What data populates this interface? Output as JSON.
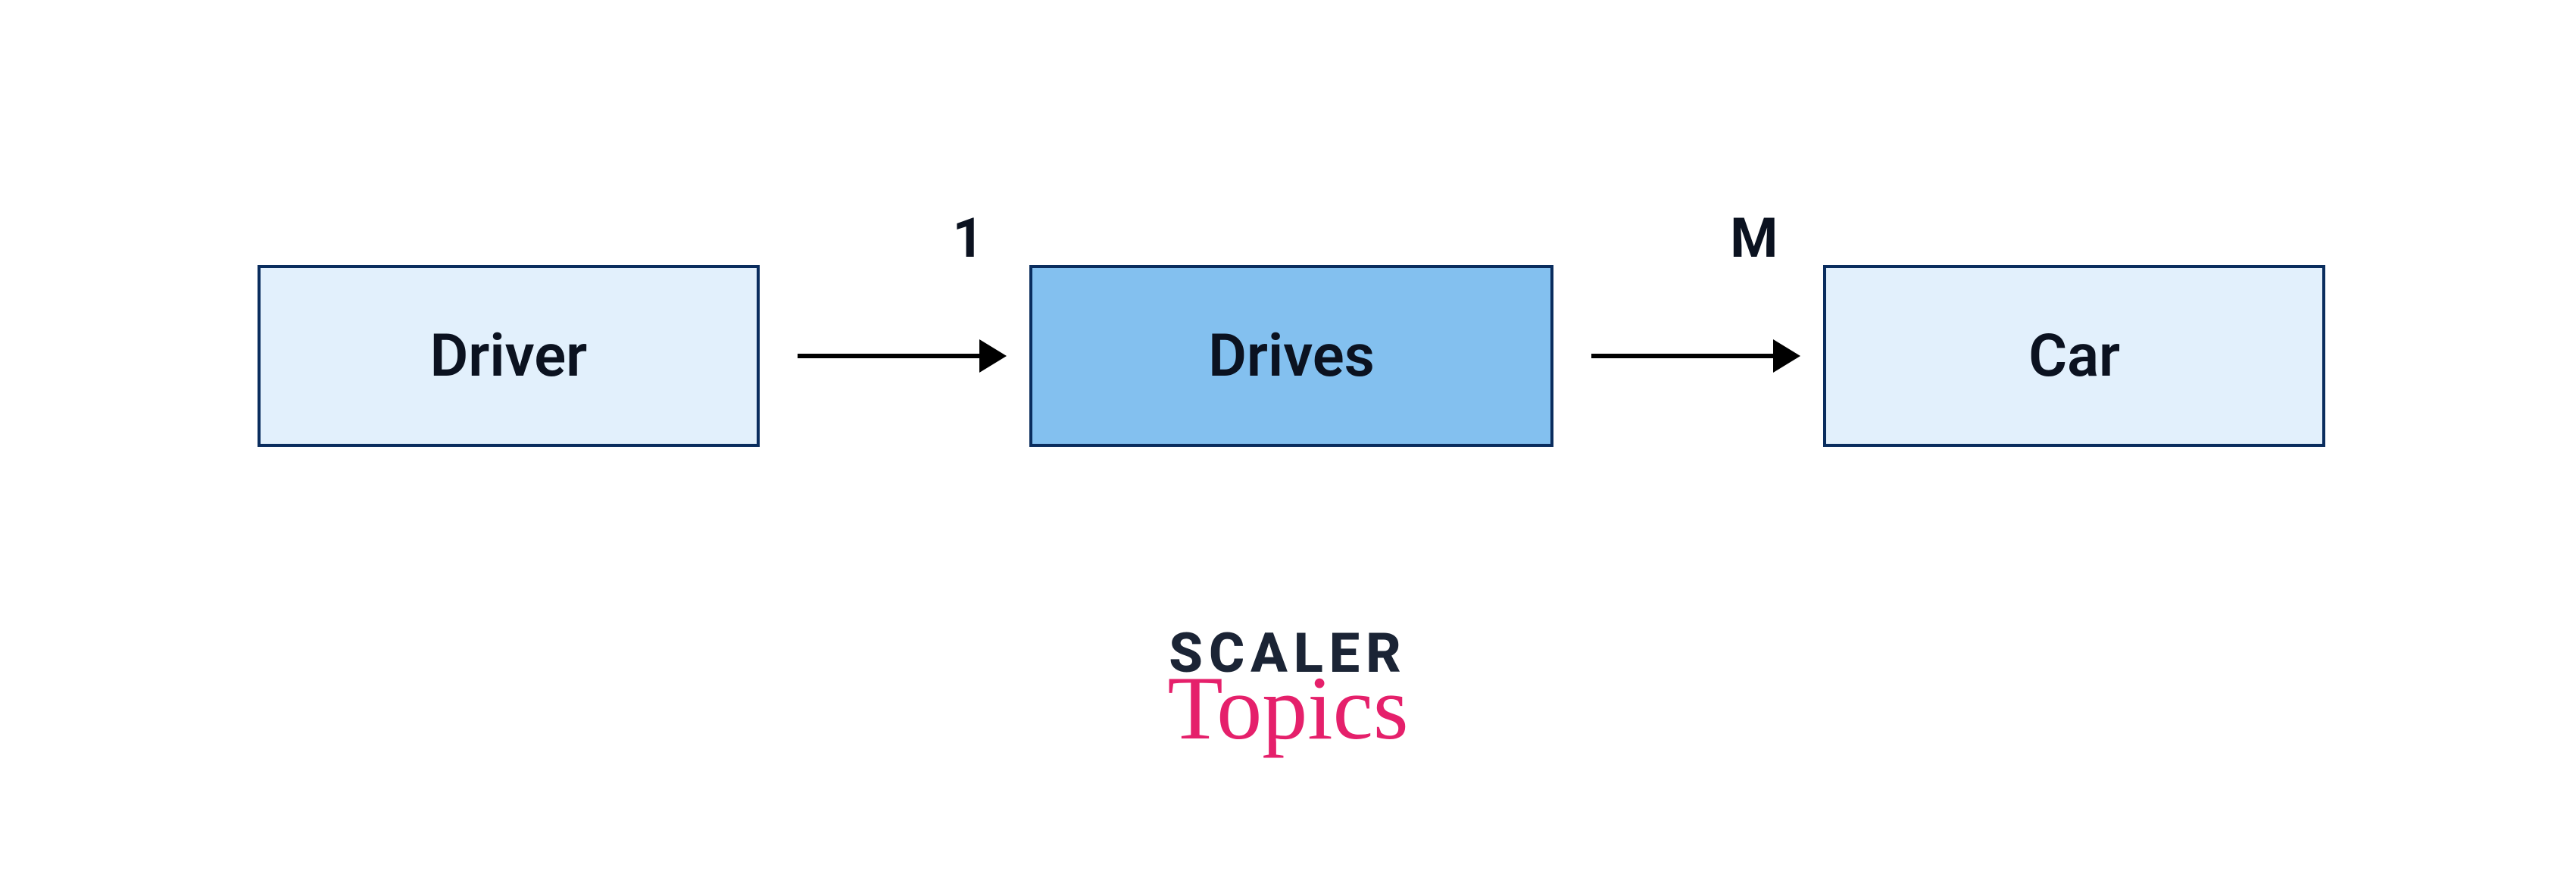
{
  "entities": {
    "left": {
      "label": "Driver"
    },
    "mid": {
      "label": "Drives"
    },
    "right": {
      "label": "Car"
    }
  },
  "cardinality": {
    "left_to_mid": "1",
    "mid_to_right": "M"
  },
  "branding": {
    "line1": "SCALER",
    "line2": "Topics"
  }
}
